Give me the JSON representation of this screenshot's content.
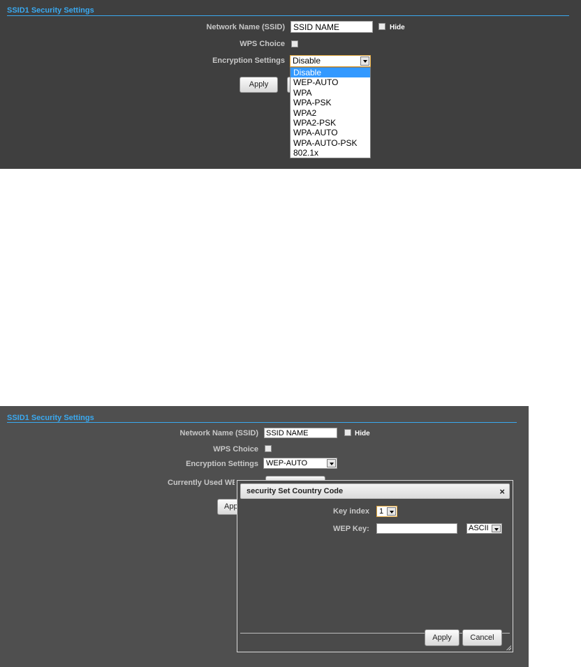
{
  "top": {
    "section_title": "SSID1 Security Settings",
    "network_name_label": "Network Name (SSID)",
    "network_name_value": "SSID NAME",
    "hide_label": "Hide",
    "wps_label": "WPS Choice",
    "encryption_label": "Encryption Settings",
    "encryption_value": "Disable",
    "apply_label": "Apply",
    "encryption_options": [
      "Disable",
      "WEP-AUTO",
      "WPA",
      "WPA-PSK",
      "WPA2",
      "WPA2-PSK",
      "WPA-AUTO",
      "WPA-AUTO-PSK",
      "802.1x"
    ],
    "selected_option": "Disable"
  },
  "bottom": {
    "section_title": "SSID1 Security Settings",
    "network_name_label": "Network Name (SSID)",
    "network_name_value": "SSID NAME",
    "hide_label": "Hide",
    "wps_label": "WPS Choice",
    "encryption_label": "Encryption Settings",
    "encryption_value": "WEP-AUTO",
    "currently_used_label": "Currently Used WE",
    "apply_partial_label": "Apply",
    "dialog": {
      "title": "security Set Country Code",
      "close_glyph": "×",
      "key_index_label": "Key index",
      "key_index_value": "1",
      "wep_key_label": "WEP Key:",
      "wep_key_value": "",
      "key_format_value": "ASCII",
      "apply_label": "Apply",
      "cancel_label": "Cancel"
    }
  }
}
